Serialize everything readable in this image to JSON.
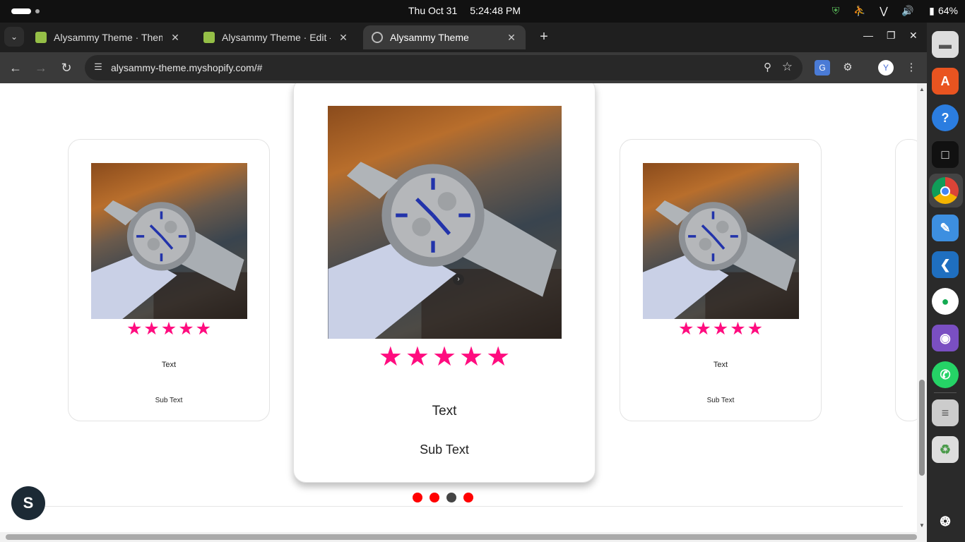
{
  "system_bar": {
    "date": "Thu Oct 31",
    "time": "5:24:48 PM",
    "battery": "64%"
  },
  "tabs": [
    {
      "title": "Alysammy Theme · Them",
      "favicon": "shopify-icon"
    },
    {
      "title": "Alysammy Theme · Edit -",
      "favicon": "shopify-icon"
    },
    {
      "title": "Alysammy Theme",
      "favicon": "globe-icon",
      "active": true
    }
  ],
  "address_bar": {
    "url": "alysammy-theme.myshopify.com/#"
  },
  "carousel": {
    "star_color": "#ff0c7f",
    "cards": [
      {
        "rating": 5,
        "title": "Text",
        "subtitle": "Sub Text"
      },
      {
        "rating": 5,
        "title": "Text",
        "subtitle": "Sub Text",
        "featured": true
      },
      {
        "rating": 5,
        "title": "Text",
        "subtitle": "Sub Text"
      }
    ],
    "pagination": {
      "count": 4,
      "current": 3,
      "dot_color": "#ff0000"
    }
  },
  "dock_apps": [
    "files-icon",
    "app-center-icon",
    "help-icon",
    "remote-desktop-icon",
    "chrome-icon",
    "text-editor-icon",
    "vscode-icon",
    "mongodb-compass-icon",
    "github-desktop-icon",
    "whatsapp-icon",
    "archive-icon",
    "trash-icon",
    "ubuntu-apps-icon"
  ]
}
